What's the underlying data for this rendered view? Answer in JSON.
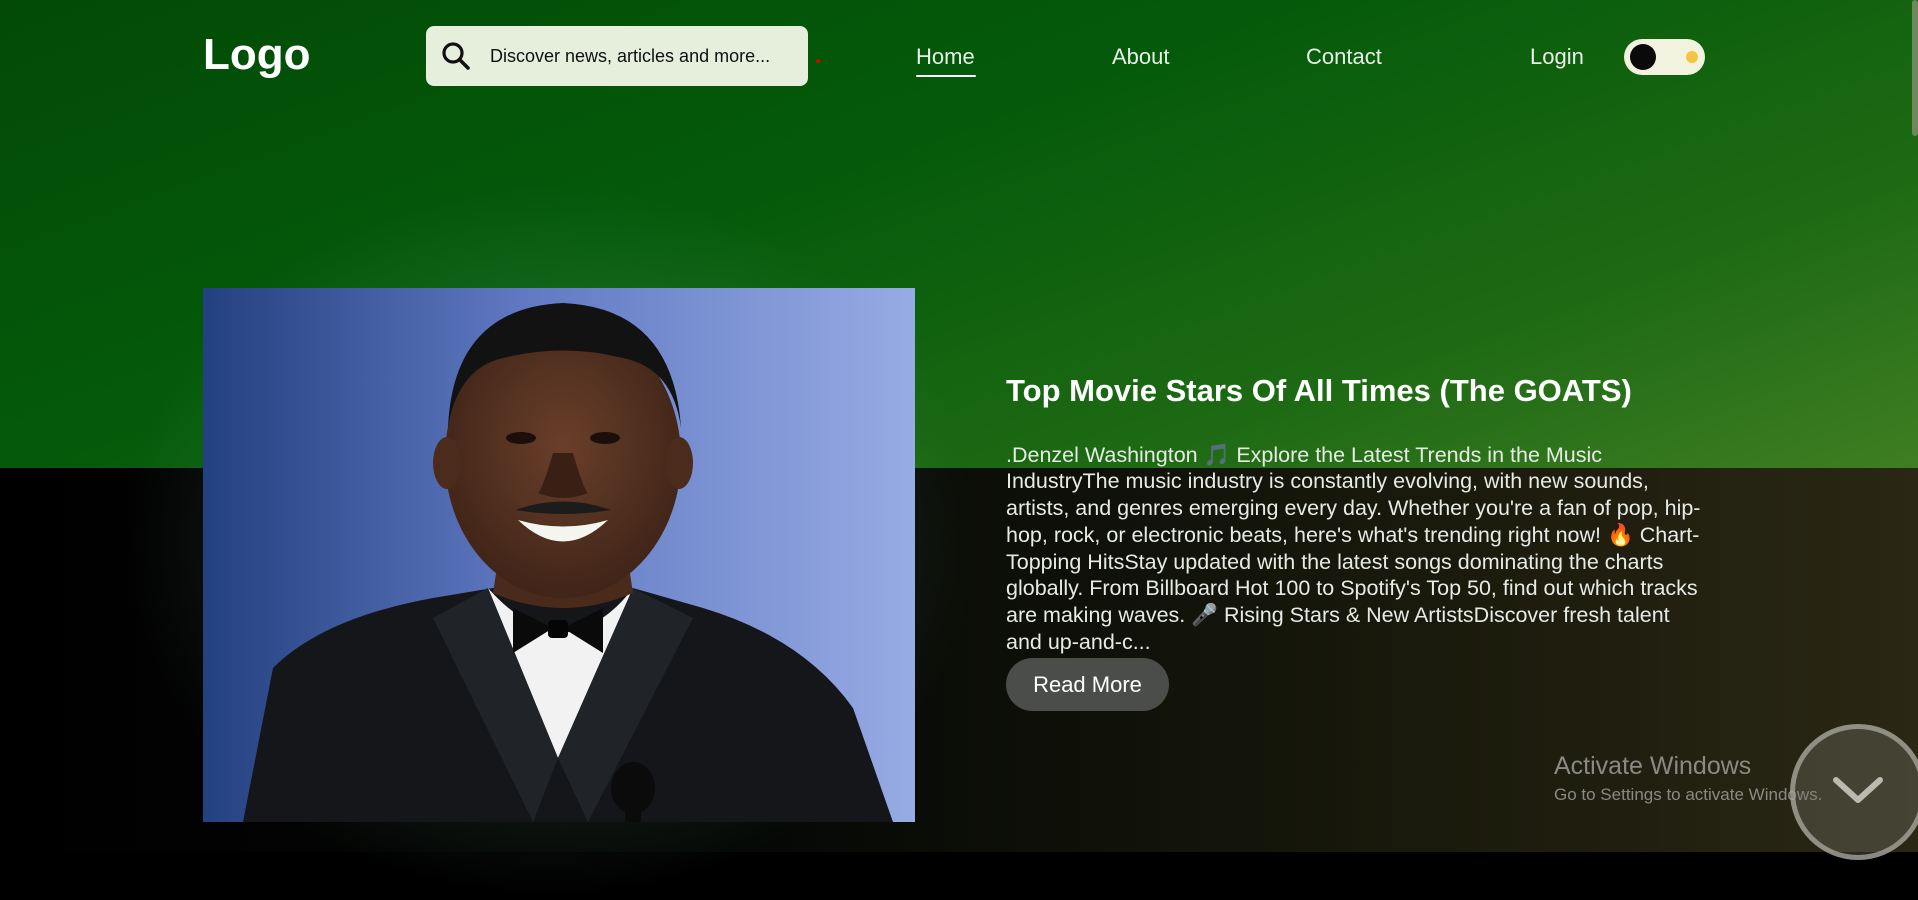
{
  "header": {
    "logo": "Logo",
    "search": {
      "placeholder": "Discover news, articles and more..."
    },
    "nav": [
      {
        "label": "Home",
        "active": true
      },
      {
        "label": "About"
      },
      {
        "label": "Contact"
      }
    ],
    "login_label": "Login"
  },
  "hero": {
    "title": "Top Movie Stars Of All Times (The GOATS)",
    "excerpt": ".Denzel Washington 🎵 Explore the Latest Trends in the Music IndustryThe music industry is constantly evolving, with new sounds, artists, and genres emerging every day. Whether you're a fan of pop, hip-hop, rock, or electronic beats, here's what's trending right now! 🔥 Chart-Topping HitsStay updated with the latest songs dominating the charts globally. From Billboard Hot 100 to Spotify's Top 50, find out which tracks are making waves. 🎤 Rising Stars & New ArtistsDiscover fresh talent and up-and-c...",
    "read_more_label": "Read More"
  },
  "windows_watermark": {
    "title": "Activate Windows",
    "subtitle": "Go to Settings to activate Windows."
  },
  "colors": {
    "header_green": "#045a0a",
    "search_bg": "#e6eedc",
    "button_bg": "#4b4d4a",
    "toggle_bg": "#f1f3de",
    "sun": "#f4c542"
  },
  "icons": {
    "search": "search-icon",
    "scroll": "chevron-down-icon",
    "theme_toggle": "theme-toggle-icon"
  }
}
